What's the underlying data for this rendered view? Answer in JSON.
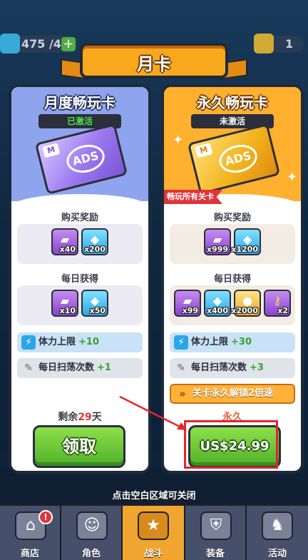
{
  "topbar": {
    "energy": "475 /40",
    "gold": "",
    "gems": "",
    "ads_tickets": "1"
  },
  "banner": {
    "title": "月卡"
  },
  "cards": {
    "monthly": {
      "title": "月度畅玩卡",
      "status": "已激活",
      "buy_reward_label": "购买奖励",
      "buy_rewards": [
        {
          "icon": "ads-ticket-icon",
          "qty": "x40"
        },
        {
          "icon": "gem-icon",
          "qty": "x200"
        }
      ],
      "daily_label": "每日获得",
      "daily_rewards": [
        {
          "icon": "ads-ticket-icon",
          "qty": "x10"
        },
        {
          "icon": "gem-icon",
          "qty": "x50"
        }
      ],
      "perk1": {
        "text": "体力上限",
        "bonus": "+10"
      },
      "perk2": {
        "text": "每日扫荡次数",
        "bonus": "+1"
      },
      "remain_prefix": "剩余",
      "remain_days": "29",
      "remain_suffix": "天",
      "button": "领取"
    },
    "permanent": {
      "title": "永久畅玩卡",
      "status": "未激活",
      "tag": "畅玩所有关卡",
      "buy_reward_label": "购买奖励",
      "buy_rewards": [
        {
          "icon": "ads-ticket-icon",
          "qty": "x999"
        },
        {
          "icon": "gem-icon",
          "qty": "x1200"
        }
      ],
      "daily_label": "每日获得",
      "daily_rewards": [
        {
          "icon": "ads-ticket-icon",
          "qty": "x99"
        },
        {
          "icon": "gem-icon",
          "qty": "x400"
        },
        {
          "icon": "gold-coin-icon",
          "qty": "x2000"
        },
        {
          "icon": "key-icon",
          "qty": "x2"
        }
      ],
      "perk1": {
        "text": "体力上限",
        "bonus": "+30"
      },
      "perk2": {
        "text": "每日扫荡次数",
        "bonus": "+3"
      },
      "perk3": {
        "text": "关卡永久解锁2倍速"
      },
      "duration": "永久",
      "price": "US$24.99"
    }
  },
  "hint": "点击空白区域可关闭",
  "nav": [
    {
      "label": "商店",
      "icon": "shop-icon"
    },
    {
      "label": "角色",
      "icon": "character-icon"
    },
    {
      "label": "战斗",
      "icon": "battle-icon"
    },
    {
      "label": "装备",
      "icon": "equipment-icon"
    },
    {
      "label": "活动",
      "icon": "event-icon"
    }
  ],
  "nav_badge": "!",
  "colors": {
    "accent": "#f7a81d",
    "green": "#4fb12a",
    "highlight": "#e2262c"
  }
}
